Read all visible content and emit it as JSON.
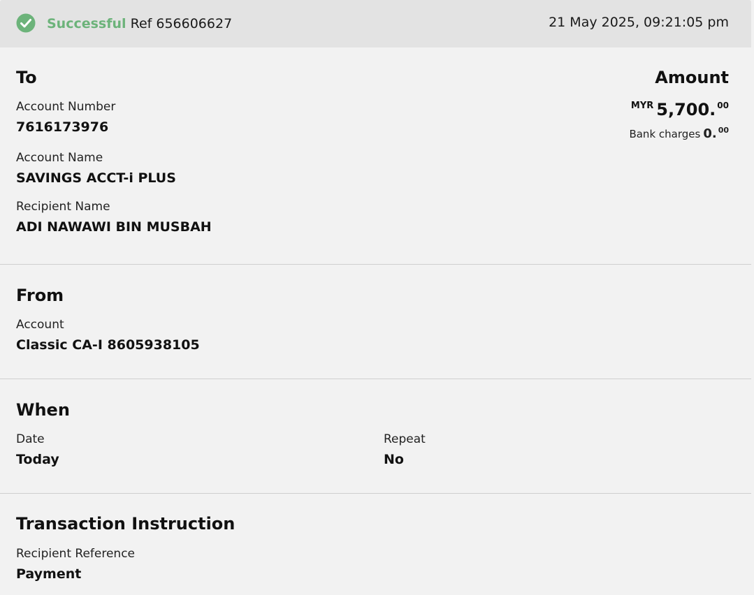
{
  "status": {
    "state": "Successful",
    "reference": "Ref 656606627",
    "timestamp": "21 May 2025, 09:21:05 pm"
  },
  "to": {
    "heading": "To",
    "account_number_label": "Account Number",
    "account_number": "7616173976",
    "account_name_label": "Account Name",
    "account_name": "SAVINGS ACCT-i PLUS",
    "recipient_name_label": "Recipient Name",
    "recipient_name": "ADI NAWAWI BIN MUSBAH"
  },
  "amount": {
    "heading": "Amount",
    "currency": "MYR",
    "whole": "5,700.",
    "cents": "00",
    "bank_charges_label": "Bank charges",
    "bank_charges_whole": "0.",
    "bank_charges_cents": "00"
  },
  "from": {
    "heading": "From",
    "account_label": "Account",
    "account": "Classic CA-I 8605938105"
  },
  "when": {
    "heading": "When",
    "date_label": "Date",
    "date": "Today",
    "repeat_label": "Repeat",
    "repeat": "No"
  },
  "instruction": {
    "heading": "Transaction Instruction",
    "recipient_reference_label": "Recipient Reference",
    "recipient_reference": "Payment"
  },
  "icons": {
    "status_icon": "check-circle-icon"
  },
  "colors": {
    "success": "#6cb37a",
    "header_bg": "#e3e3e3",
    "page_bg": "#f2f2f2"
  }
}
